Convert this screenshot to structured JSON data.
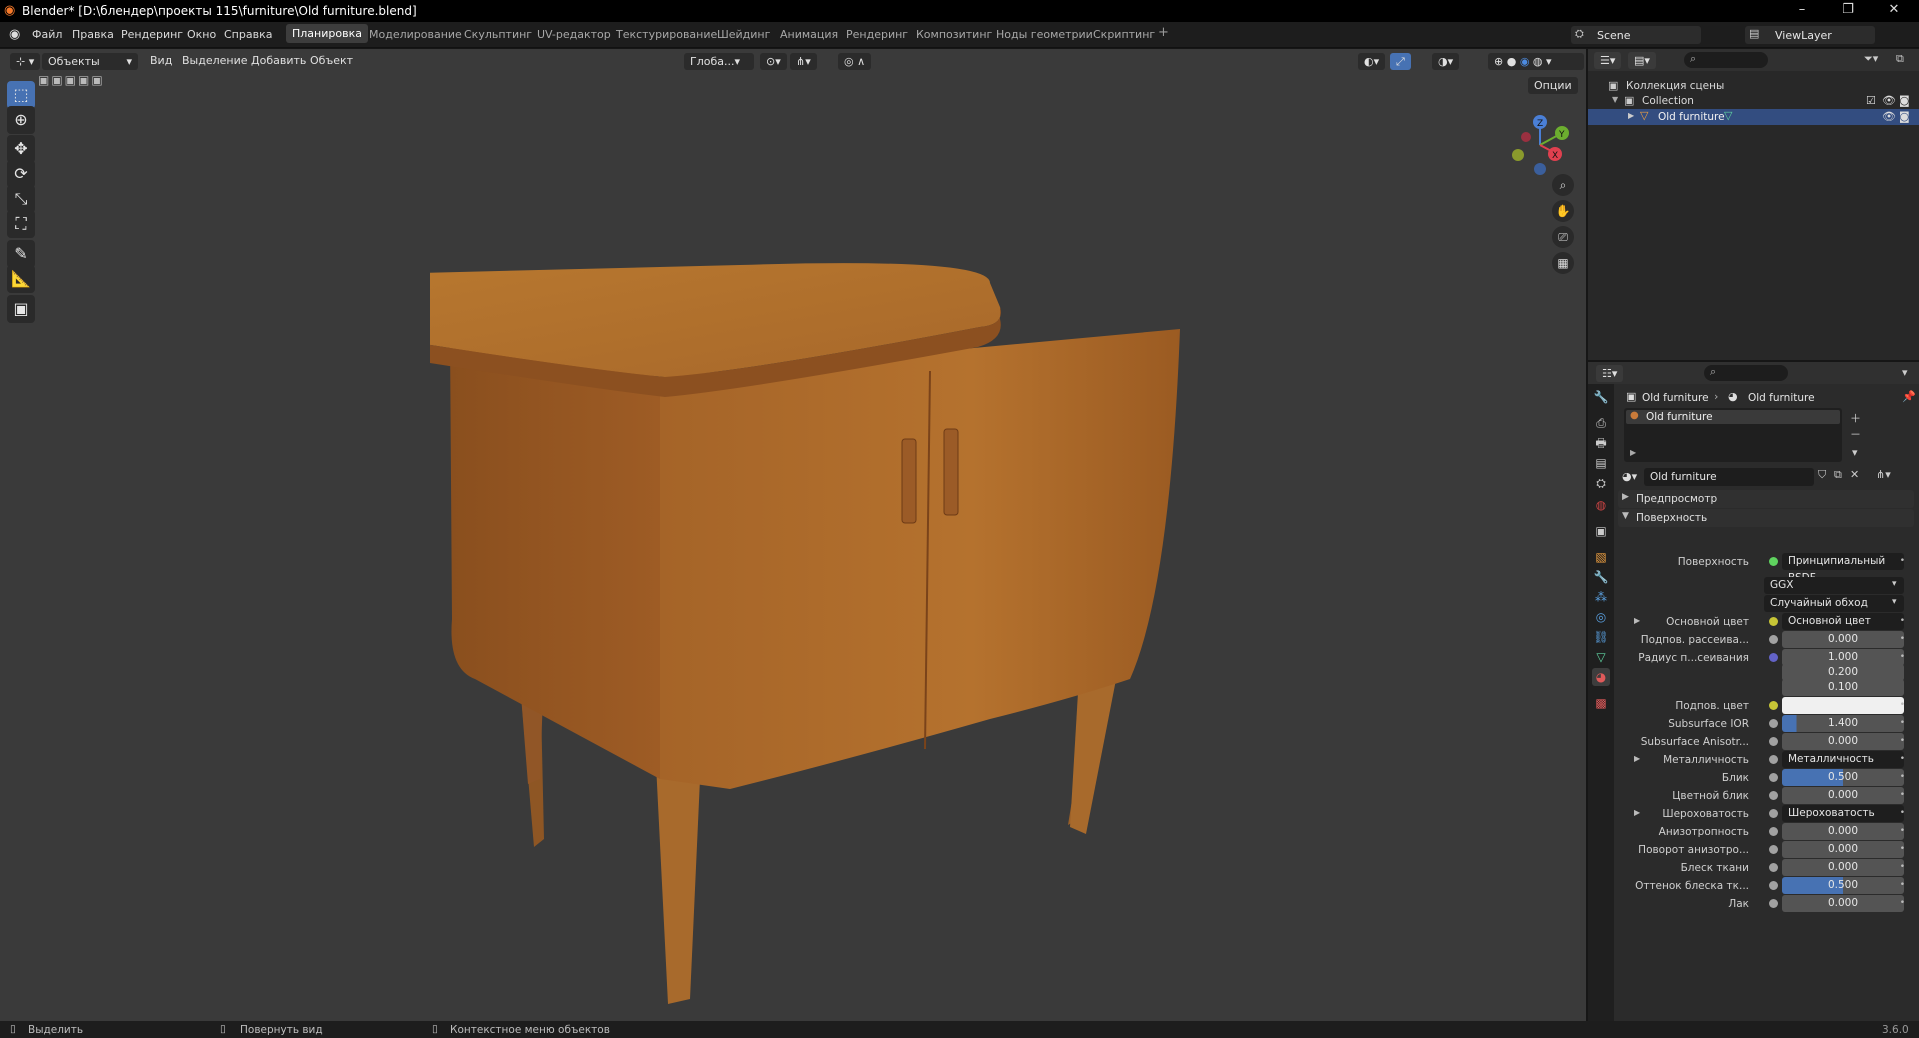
{
  "window": {
    "title": "Blender* [D:\\блендер\\проекты 115\\furniture\\Old furniture.blend]",
    "minimize": "–",
    "restore": "❐",
    "close": "✕"
  },
  "menu": [
    "Файл",
    "Правка",
    "Рендеринг",
    "Окно",
    "Справка"
  ],
  "workspaces": [
    "Планировка",
    "Моделирование",
    "Скульптинг",
    "UV-редактор",
    "Текстурирование",
    "Шейдинг",
    "Анимация",
    "Рендеринг",
    "Композитинг",
    "Ноды геометрии",
    "Скриптинг"
  ],
  "workspace_add": "+",
  "scene": {
    "name": "Scene",
    "viewlayer": "ViewLayer"
  },
  "viewport": {
    "mode": "Объекты",
    "menus": [
      "Вид",
      "Выделение",
      "Добавить",
      "Объект"
    ],
    "orientation": "Глоба...",
    "options": "Опции",
    "gizmo": {
      "x": "X",
      "y": "Y",
      "z": "Z"
    }
  },
  "outliner": {
    "scene_collection": "Коллекция сцены",
    "collection": "Collection",
    "object": "Old furniture"
  },
  "properties": {
    "breadcrumb_object": "Old furniture",
    "breadcrumb_material": "Old furniture",
    "slot": "Old furniture",
    "material_name": "Old furniture",
    "panel_preview": "Предпросмотр",
    "panel_surface": "Поверхность",
    "rows": [
      {
        "label": "Поверхность",
        "value": "Принципиальный BSDF",
        "kind": "link",
        "dot": "green"
      },
      {
        "label": "",
        "value": "GGX",
        "kind": "dropdown"
      },
      {
        "label": "",
        "value": "Случайный обход",
        "kind": "dropdown"
      },
      {
        "label": "Основной цвет",
        "value": "Основной цвет",
        "kind": "link",
        "dot": "yellow",
        "expand": true
      },
      {
        "label": "Подпов. рассеива...",
        "value": "0.000",
        "kind": "num",
        "dot": "gray",
        "fill": 0
      },
      {
        "label": "Радиус п...сеивания",
        "value": "1.000",
        "kind": "num",
        "dot": "blue",
        "fill": 0
      },
      {
        "label": "",
        "value": "0.200",
        "kind": "num",
        "fill": 0
      },
      {
        "label": "",
        "value": "0.100",
        "kind": "num",
        "fill": 0
      },
      {
        "label": "Подпов. цвет",
        "value": "",
        "kind": "color",
        "dot": "yellow"
      },
      {
        "label": "Subsurface IOR",
        "value": "1.400",
        "kind": "num",
        "dot": "gray",
        "fill": 0.12
      },
      {
        "label": "Subsurface Anisotr...",
        "value": "0.000",
        "kind": "num",
        "dot": "gray",
        "fill": 0
      },
      {
        "label": "Металличность",
        "value": "Металличность",
        "kind": "link",
        "dot": "gray",
        "expand": true
      },
      {
        "label": "Блик",
        "value": "0.500",
        "kind": "num",
        "dot": "gray",
        "fill": 0.5
      },
      {
        "label": "Цветной блик",
        "value": "0.000",
        "kind": "num",
        "dot": "gray",
        "fill": 0
      },
      {
        "label": "Шероховатость",
        "value": "Шероховатость",
        "kind": "link",
        "dot": "gray",
        "expand": true
      },
      {
        "label": "Анизотропность",
        "value": "0.000",
        "kind": "num",
        "dot": "gray",
        "fill": 0
      },
      {
        "label": "Поворот анизотро...",
        "value": "0.000",
        "kind": "num",
        "dot": "gray",
        "fill": 0
      },
      {
        "label": "Блеск ткани",
        "value": "0.000",
        "kind": "num",
        "dot": "gray",
        "fill": 0
      },
      {
        "label": "Оттенок блеска тк...",
        "value": "0.500",
        "kind": "num",
        "dot": "gray",
        "fill": 0.5
      },
      {
        "label": "Лак",
        "value": "0.000",
        "kind": "num",
        "dot": "gray",
        "fill": 0
      }
    ]
  },
  "status": {
    "select": "Выделить",
    "rotate": "Повернуть вид",
    "context": "Контекстное меню объектов",
    "version": "3.6.0"
  }
}
